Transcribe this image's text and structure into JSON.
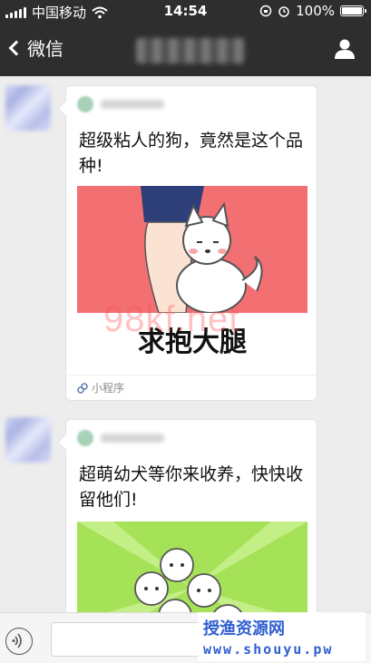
{
  "status_bar": {
    "carrier": "中国移动",
    "time": "14:54",
    "battery": "100%"
  },
  "nav": {
    "back_label": "微信"
  },
  "messages": [
    {
      "title": "超级粘人的狗，竟然是这个品种!",
      "image_caption": "求抱大腿",
      "footer_label": "小程序"
    },
    {
      "title": "超萌幼犬等你来收养，快快收留他们!"
    }
  ],
  "watermarks": {
    "center": "98kf.net",
    "corner_line1": "授渔资源网",
    "corner_line2": "www.shouyu.pw"
  },
  "colors": {
    "nav_bg": "#2e2e2e",
    "chat_bg": "#ededed",
    "image1_bg": "#f26f72",
    "image2_bg": "#a5e257"
  }
}
